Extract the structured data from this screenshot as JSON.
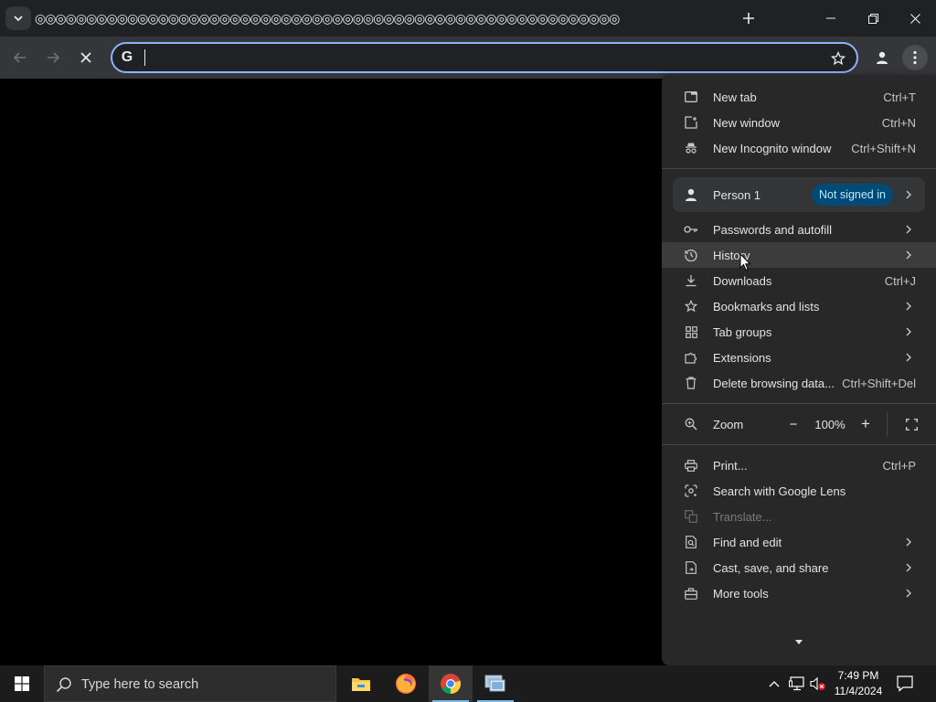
{
  "browser": {
    "tab_strip_title": "◎◎◎◎◎◎◎◎◎◎◎◎◎◎◎◎◎◎◎◎◎◎◎◎◎◎◎◎◎◎◎◎◎◎◎◎◎◎◎◎◎◎◎◎◎◎◎◎◎◎◎◎◎◎◎◎◎",
    "omnibox": {
      "value": "",
      "engine_icon": "google-g-icon",
      "engine_glyph": "G"
    },
    "accent_color": "#8ab4f8"
  },
  "menu": {
    "group1": [
      {
        "label": "New tab",
        "shortcut": "Ctrl+T",
        "icon": "new-tab-icon"
      },
      {
        "label": "New window",
        "shortcut": "Ctrl+N",
        "icon": "new-window-icon"
      },
      {
        "label": "New Incognito window",
        "shortcut": "Ctrl+Shift+N",
        "icon": "incognito-icon"
      }
    ],
    "profile": {
      "name": "Person 1",
      "status": "Not signed in",
      "status_color": "#004a77"
    },
    "group2": [
      {
        "label": "Passwords and autofill",
        "submenu": true,
        "icon": "key-icon"
      },
      {
        "label": "History",
        "submenu": true,
        "icon": "history-icon",
        "hovered": true
      },
      {
        "label": "Downloads",
        "shortcut": "Ctrl+J",
        "icon": "download-icon"
      },
      {
        "label": "Bookmarks and lists",
        "submenu": true,
        "icon": "star-icon"
      },
      {
        "label": "Tab groups",
        "submenu": true,
        "icon": "grid-icon"
      },
      {
        "label": "Extensions",
        "submenu": true,
        "icon": "puzzle-icon"
      },
      {
        "label": "Delete browsing data...",
        "shortcut": "Ctrl+Shift+Del",
        "icon": "trash-icon"
      }
    ],
    "zoom": {
      "label": "Zoom",
      "value": "100%",
      "minus": "−",
      "plus": "+"
    },
    "group3": [
      {
        "label": "Print...",
        "shortcut": "Ctrl+P",
        "icon": "print-icon"
      },
      {
        "label": "Search with Google Lens",
        "icon": "lens-icon"
      },
      {
        "label": "Translate...",
        "icon": "translate-icon",
        "disabled": true
      },
      {
        "label": "Find and edit",
        "submenu": true,
        "icon": "find-icon"
      },
      {
        "label": "Cast, save, and share",
        "submenu": true,
        "icon": "share-icon"
      },
      {
        "label": "More tools",
        "submenu": true,
        "icon": "toolbox-icon"
      }
    ]
  },
  "taskbar": {
    "search_placeholder": "Type here to search",
    "time": "7:49 PM",
    "date": "11/4/2024",
    "apps": [
      "file-explorer-icon",
      "firefox-icon",
      "chrome-icon",
      "remote-desktop-icon"
    ]
  }
}
